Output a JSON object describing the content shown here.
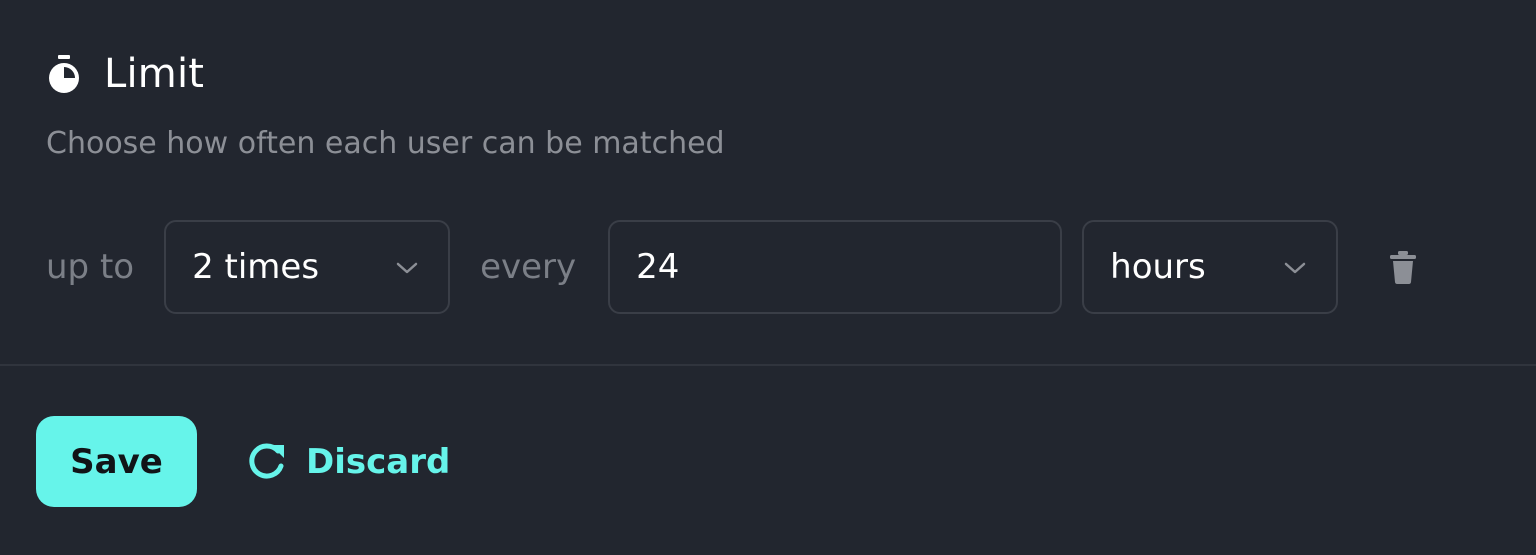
{
  "header": {
    "icon": "timer-icon",
    "title": "Limit",
    "subtitle": "Choose how often each user can be matched"
  },
  "rule": {
    "prefix": "up to",
    "frequency_selected": "2 times",
    "separator": "every",
    "interval_value": "24",
    "unit_selected": "hours",
    "delete_icon": "trash-icon"
  },
  "actions": {
    "save_label": "Save",
    "discard_label": "Discard",
    "discard_icon": "refresh-icon"
  },
  "colors": {
    "background": "#22262f",
    "accent": "#66f4ea",
    "muted_text": "#8c8f96",
    "border": "#3a3e47"
  }
}
